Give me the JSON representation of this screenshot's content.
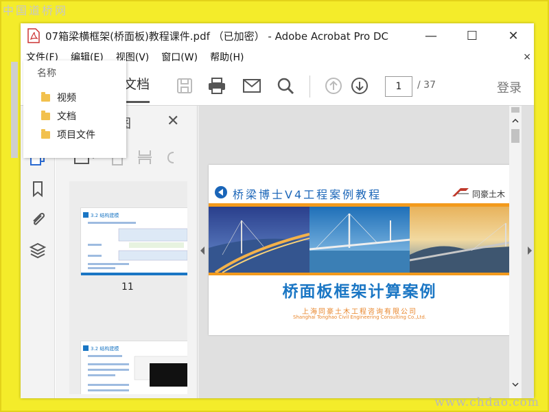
{
  "watermarks": {
    "top": "中国道桥网",
    "bottom": "www.chdao.com"
  },
  "window": {
    "title": "07箱梁横框架(桥面板)教程课件.pdf （已加密） - Adobe Acrobat Pro DC"
  },
  "window_controls": {
    "minimize": "—",
    "maximize": "☐",
    "close": "✕"
  },
  "menu": {
    "items": [
      "文件(F)",
      "编辑(E)",
      "视图(V)",
      "窗口(W)",
      "帮助(H)"
    ],
    "close": "×"
  },
  "toolbar": {
    "tab_label": "文档",
    "page_current": "1",
    "page_total": "/ 37",
    "login_label": "登录"
  },
  "panel": {
    "title": "图",
    "close": "✕",
    "thumbnails": [
      {
        "label": "11"
      }
    ]
  },
  "popup": {
    "header": "名称",
    "items": [
      "视频",
      "文档",
      "项目文件"
    ]
  },
  "document": {
    "head_title": "桥梁博士V4工程案例教程",
    "logo_text": "同豪土木",
    "main_title": "桥面板框架计算案例",
    "company_cn": "上海同豪土木工程咨询有限公司",
    "company_en": "Shanghai Tonghao Civil Engineering Consulting Co.,Ltd."
  },
  "thumb_texts": {
    "t1_title": "3.2 结构建模",
    "t2_title": "3.2 结构建模"
  },
  "colors": {
    "accent_orange": "#f39a1c",
    "title_blue": "#1a76c4",
    "background_yellow": "#f4ec2a"
  }
}
